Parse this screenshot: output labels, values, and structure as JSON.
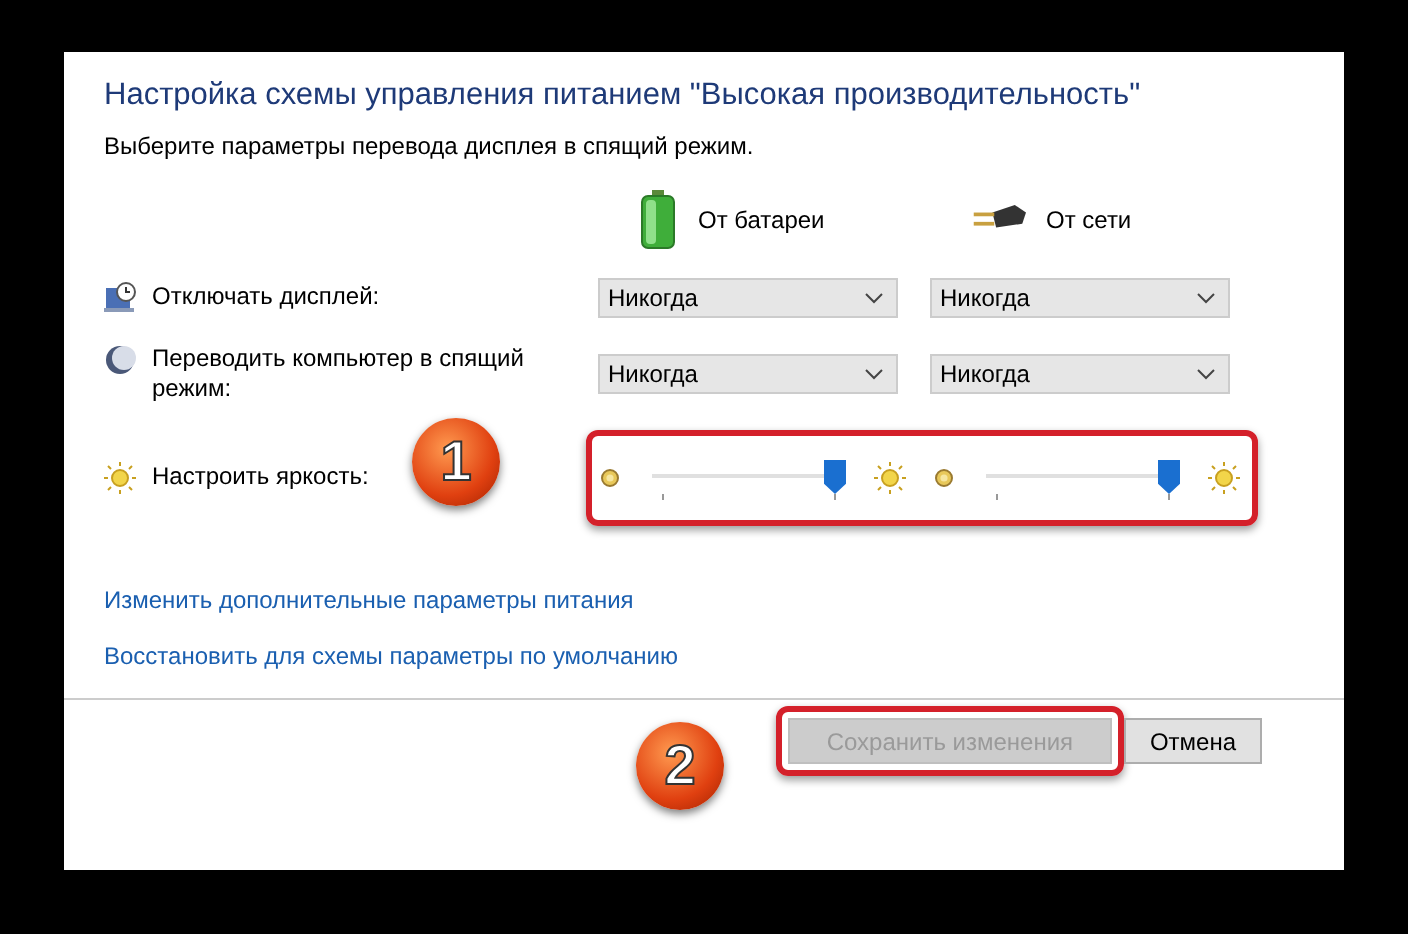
{
  "title": "Настройка схемы управления питанием \"Высокая производительность\"",
  "subtitle": "Выберите параметры перевода дисплея в спящий режим.",
  "columns": [
    {
      "label": "От батареи",
      "kind": "battery"
    },
    {
      "label": "От сети",
      "kind": "plug"
    }
  ],
  "settings": [
    {
      "kind": "dropdown",
      "label": "Отключать дисплей:",
      "values": [
        "Никогда",
        "Никогда"
      ]
    },
    {
      "kind": "dropdown",
      "label": "Переводить компьютер в спящий режим:",
      "values": [
        "Никогда",
        "Никогда"
      ]
    },
    {
      "kind": "slider",
      "label": "Настроить яркость:",
      "sliders": [
        {
          "level": 1
        },
        {
          "level": 1
        }
      ]
    }
  ],
  "links": [
    "Изменить дополнительные параметры питания",
    "Восстановить для схемы параметры по умолчанию"
  ],
  "buttons": [
    {
      "label": "Сохранить изменения",
      "disabled": true
    },
    {
      "label": "Отмена",
      "disabled": false
    }
  ],
  "callouts": [
    "1",
    "2"
  ]
}
